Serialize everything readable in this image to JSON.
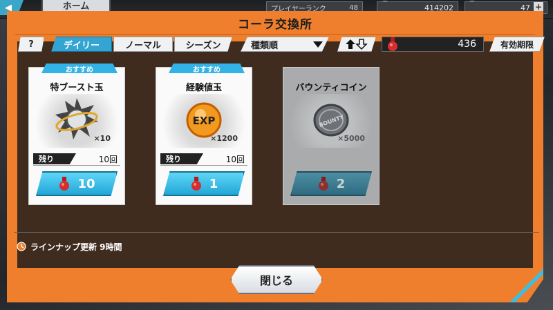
{
  "topbar": {
    "home_label": "ホーム",
    "player_rank_label": "プレイヤーランク",
    "player_rank_value": "48",
    "coins": "414202",
    "gems": "47"
  },
  "modal": {
    "title": "コーラ交換所",
    "help_label": "?",
    "tabs": [
      {
        "label": "デイリー",
        "active": true
      },
      {
        "label": "ノーマル",
        "active": false
      },
      {
        "label": "シーズン",
        "active": false
      }
    ],
    "sort_label": "種類順",
    "cola_count": "436",
    "expiry_label": "有効期限",
    "lineup_update": "ラインナップ更新 9時間",
    "close_label": "閉じる"
  },
  "cards": [
    {
      "recommended": "おすすめ",
      "name": "特ブースト玉",
      "quantity": "×10",
      "remaining_label": "残り",
      "remaining_value": "10回",
      "price": "10",
      "disabled": false,
      "icon": "boost-orb-icon"
    },
    {
      "recommended": "おすすめ",
      "name": "経験値玉",
      "quantity": "×1200",
      "remaining_label": "残り",
      "remaining_value": "10回",
      "price": "1",
      "disabled": false,
      "icon": "exp-orb-icon"
    },
    {
      "recommended": "",
      "name": "バウンティコイン",
      "quantity": "×5000",
      "remaining_label": "",
      "remaining_value": "",
      "price": "2",
      "disabled": true,
      "icon": "bounty-coin-icon"
    }
  ],
  "colors": {
    "modal_orange": "#ef7f2c",
    "accent_blue": "#34a5d3",
    "price_blue": "#22a7d8"
  }
}
